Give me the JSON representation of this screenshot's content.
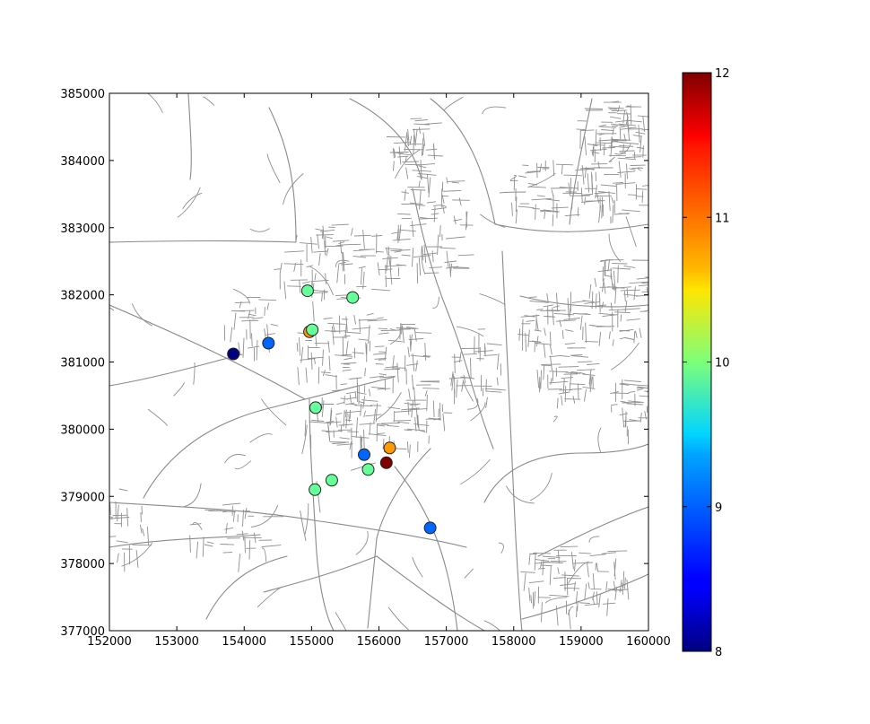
{
  "chart_data": {
    "type": "scatter",
    "title": "",
    "xlabel": "",
    "ylabel": "",
    "xlim": [
      152000,
      160000
    ],
    "ylim": [
      377000,
      385000
    ],
    "xticks": [
      "152000",
      "153000",
      "154000",
      "155000",
      "156000",
      "157000",
      "158000",
      "159000",
      "160000"
    ],
    "yticks": [
      "377000",
      "378000",
      "379000",
      "380000",
      "381000",
      "382000",
      "383000",
      "384000",
      "385000"
    ],
    "grid": false,
    "background": "road network map (grey lines)",
    "colormap": "jet",
    "colorbar": {
      "range": [
        8,
        12
      ],
      "ticks": [
        "8",
        "9",
        "10",
        "11",
        "12"
      ],
      "position": "right"
    },
    "points": [
      {
        "x": 153840,
        "y": 381120,
        "value": 8.0
      },
      {
        "x": 154360,
        "y": 381280,
        "value": 8.9
      },
      {
        "x": 154940,
        "y": 382060,
        "value": 9.9
      },
      {
        "x": 155610,
        "y": 381960,
        "value": 9.9
      },
      {
        "x": 154970,
        "y": 381450,
        "value": 10.9
      },
      {
        "x": 155010,
        "y": 381480,
        "value": 9.9
      },
      {
        "x": 155060,
        "y": 380320,
        "value": 9.9
      },
      {
        "x": 155780,
        "y": 379620,
        "value": 8.9
      },
      {
        "x": 156160,
        "y": 379720,
        "value": 10.9
      },
      {
        "x": 156110,
        "y": 379500,
        "value": 12.0
      },
      {
        "x": 155840,
        "y": 379400,
        "value": 9.9
      },
      {
        "x": 155300,
        "y": 379240,
        "value": 9.9
      },
      {
        "x": 155050,
        "y": 379100,
        "value": 9.9
      },
      {
        "x": 156760,
        "y": 378530,
        "value": 8.9
      }
    ],
    "marker_color_scale": {
      "8": "#00007f",
      "9": "#0080ff",
      "10": "#7cff79",
      "11": "#ff9000",
      "12": "#7f0000"
    }
  }
}
